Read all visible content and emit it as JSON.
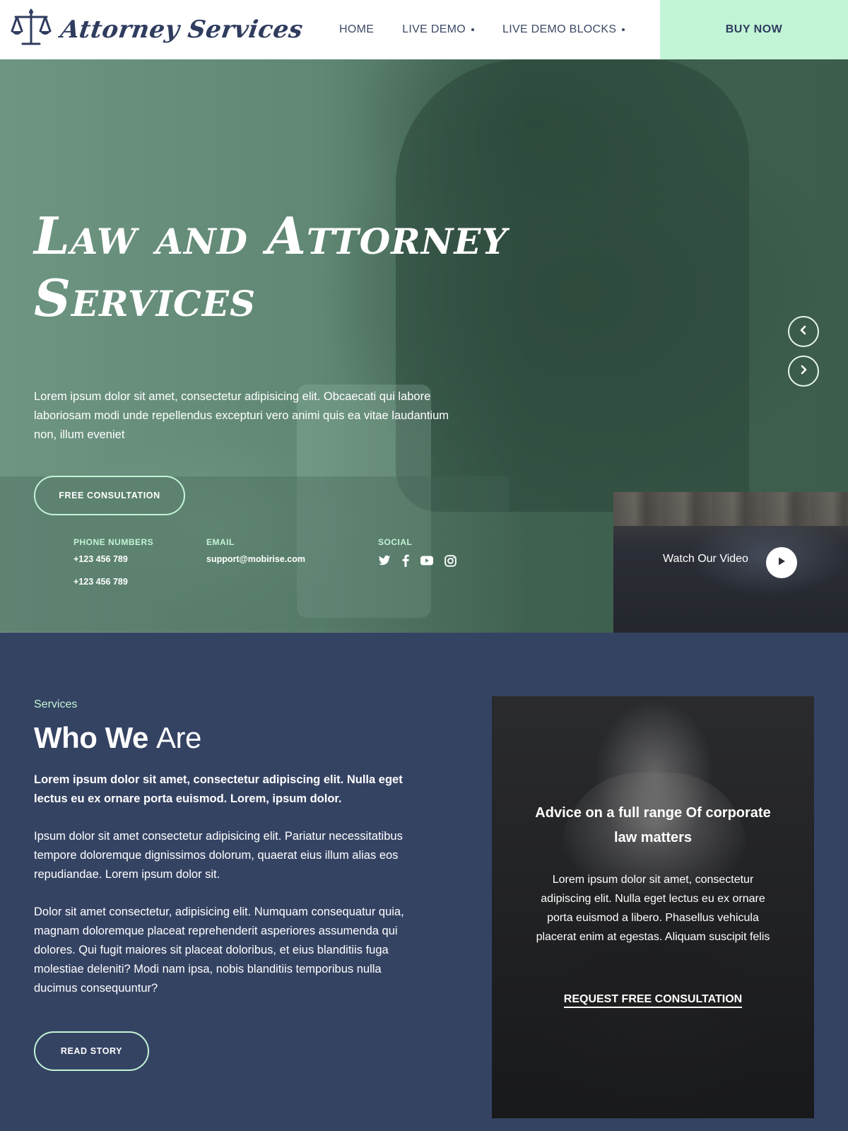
{
  "header": {
    "logo_text": "Attorney Services",
    "logo_icon": "scales-icon",
    "nav": [
      {
        "label": "HOME",
        "dropdown": false
      },
      {
        "label": "LIVE DEMO",
        "dropdown": true
      },
      {
        "label": "LIVE DEMO BLOCKS",
        "dropdown": true
      }
    ],
    "buy_label": "BUY NOW"
  },
  "hero": {
    "title": "Law and Attorney Services",
    "description": "Lorem ipsum dolor sit amet, consectetur adipisicing elit. Obcaecati qui labore laboriosam modi unde repellendus excepturi vero animi quis ea vitae laudantium non, illum eveniet",
    "cta_label": "FREE CONSULTATION",
    "prev_icon": "chevron-left-icon",
    "next_icon": "chevron-right-icon"
  },
  "contacts": {
    "phone_label": "PHONE NUMBERS",
    "phones": [
      "+123 456 789",
      "+123 456 789"
    ],
    "email_label": "EMAIL",
    "email": "support@mobirise.com",
    "social_label": "SOCIAL",
    "social_icons": [
      "twitter-icon",
      "facebook-icon",
      "youtube-icon",
      "instagram-icon"
    ]
  },
  "video": {
    "label": "Watch Our Video",
    "play_icon": "play-icon"
  },
  "about": {
    "kicker": "Services",
    "title_bold": "Who We",
    "title_light": "Are",
    "lead": "Lorem ipsum dolor sit amet, consectetur adipiscing elit. Nulla eget lectus eu ex ornare porta euismod. Lorem, ipsum dolor.",
    "para1": "Ipsum dolor sit amet consectetur adipisicing elit. Pariatur necessitatibus tempore doloremque dignissimos dolorum, quaerat eius illum alias eos repudiandae. Lorem ipsum dolor sit.",
    "para2": "Dolor sit amet consectetur, adipisicing elit. Numquam consequatur quia, magnam doloremque placeat reprehenderit asperiores assumenda qui dolores. Qui fugit maiores sit placeat doloribus, et eius blanditiis fuga molestiae deleniti? Modi nam ipsa, nobis blanditiis temporibus nulla ducimus consequuntur?",
    "read_label": "READ STORY"
  },
  "card": {
    "title": "Advice on a full range Of corporate law matters",
    "text": "Lorem ipsum dolor sit amet, consectetur adipiscing elit. Nulla eget lectus eu ex ornare porta euismod a libero. Phasellus vehicula placerat enim at egestas. Aliquam suscipit felis",
    "link_label": "REQUEST FREE CONSULTATION"
  },
  "colors": {
    "navy": "#354363",
    "mint": "#c2f4d6",
    "hero_green": "#5f8773"
  }
}
